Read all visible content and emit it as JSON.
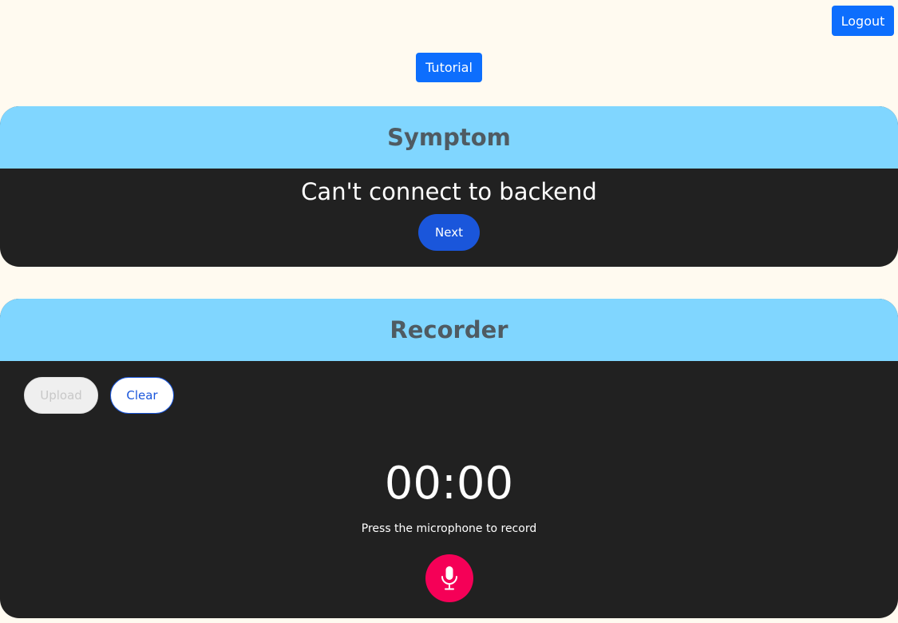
{
  "header": {
    "logout_label": "Logout",
    "tutorial_label": "Tutorial"
  },
  "symptom": {
    "title": "Symptom",
    "text": "Can't connect to backend",
    "next_label": "Next"
  },
  "recorder": {
    "title": "Recorder",
    "upload_label": "Upload",
    "clear_label": "Clear",
    "timer": "00:00",
    "hint": "Press the microphone to record",
    "mic_icon": "microphone-icon"
  },
  "colors": {
    "background": "#fffaf0",
    "card_header": "#80d6ff",
    "card_body": "#212121",
    "primary": "#0d6efd",
    "accent_button": "#1a56db",
    "mic": "#f50057"
  }
}
